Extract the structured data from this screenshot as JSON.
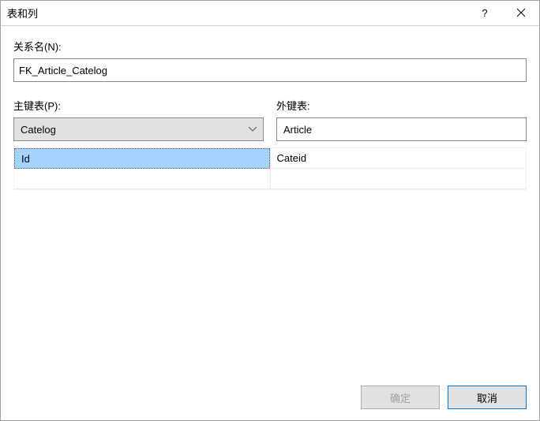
{
  "titlebar": {
    "title": "表和列",
    "help_tooltip": "?",
    "close_tooltip": "×"
  },
  "form": {
    "relation_name_label": "关系名(N):",
    "relation_name_value": "FK_Article_Catelog",
    "primary_table_label": "主键表(P):",
    "primary_table_value": "Catelog",
    "foreign_table_label": "外键表:",
    "foreign_table_value": "Article",
    "grid": {
      "primary_col": [
        "Id",
        ""
      ],
      "foreign_col": [
        "Cateid",
        ""
      ]
    }
  },
  "footer": {
    "ok_label": "确定",
    "cancel_label": "取消"
  }
}
